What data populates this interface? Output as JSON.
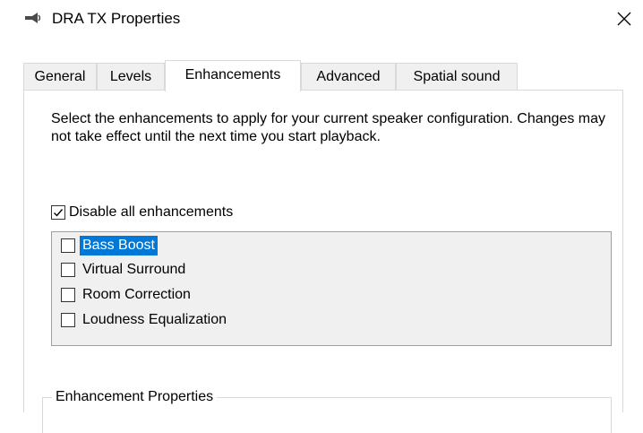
{
  "window": {
    "title": "DRA TX Properties",
    "close_glyph": "✕",
    "icon": "speaker-icon"
  },
  "tabs": [
    {
      "label": "General",
      "active": false
    },
    {
      "label": "Levels",
      "active": false
    },
    {
      "label": "Enhancements",
      "active": true
    },
    {
      "label": "Advanced",
      "active": false
    },
    {
      "label": "Spatial sound",
      "active": false
    }
  ],
  "enhancements": {
    "description": "Select the enhancements to apply for your current speaker configuration. Changes may not take effect until the next time you start playback.",
    "disable_all": {
      "label": "Disable all enhancements",
      "checked": true
    },
    "items": [
      {
        "label": "Bass Boost",
        "checked": false,
        "selected": true
      },
      {
        "label": "Virtual Surround",
        "checked": false,
        "selected": false
      },
      {
        "label": "Room Correction",
        "checked": false,
        "selected": false
      },
      {
        "label": "Loudness Equalization",
        "checked": false,
        "selected": false
      }
    ],
    "properties_group_title": "Enhancement Properties"
  },
  "colors": {
    "selection": "#0078d7",
    "list_background": "#f0f0f0",
    "tab_border": "#d9d9d9"
  }
}
